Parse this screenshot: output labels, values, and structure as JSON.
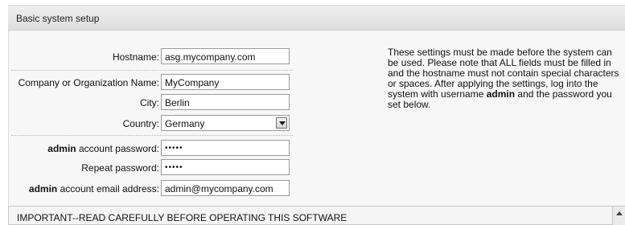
{
  "header": {
    "title": "Basic system setup"
  },
  "form": {
    "hostname": {
      "label": "Hostname:",
      "value": "asg.mycompany.com"
    },
    "company": {
      "label": "Company or Organization Name:",
      "value": "MyCompany"
    },
    "city": {
      "label": "City:",
      "value": "Berlin"
    },
    "country": {
      "label": "Country:",
      "value": "Germany"
    },
    "admin_password": {
      "label_bold": "admin",
      "label_rest": " account password:",
      "value": "•••••"
    },
    "repeat_password": {
      "label": "Repeat password:",
      "value": "•••••"
    },
    "admin_email": {
      "label_bold": "admin",
      "label_rest": " account email address:",
      "value": "admin@mycompany.com"
    }
  },
  "info": {
    "line1": "These settings must be made before the system can",
    "line2": "be used. Please note that ALL fields must be filled in",
    "line3": "and the hostname must not contain special characters",
    "line4": "or spaces. After applying the settings, log into the",
    "line5_pre": "system with username ",
    "line5_bold": "admin",
    "line5_post": " and the password you",
    "line6": "set below."
  },
  "license": {
    "text": "IMPORTANT--READ CAREFULLY BEFORE OPERATING THIS SOFTWARE"
  }
}
